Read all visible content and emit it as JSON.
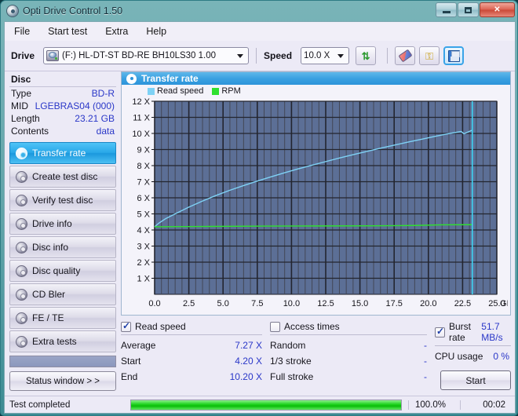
{
  "window": {
    "title": "Opti Drive Control 1.50",
    "app_icon": "disc-icon",
    "minimize": "minimize-icon",
    "maximize": "maximize-icon",
    "close": "✕"
  },
  "menu": [
    "File",
    "Start test",
    "Extra",
    "Help"
  ],
  "toolbar": {
    "drive_label": "Drive",
    "drive_value": "(F:)  HL-DT-ST BD-RE  BH10LS30 1.00",
    "speed_label": "Speed",
    "speed_value": "10.0 X",
    "refresh_icon": "refresh-icon",
    "eraser_icon": "eraser-icon",
    "key_icon": "key-icon",
    "save_icon": "save-icon"
  },
  "disc": {
    "heading": "Disc",
    "rows": [
      {
        "label": "Type",
        "value": "BD-R"
      },
      {
        "label": "MID",
        "value": "LGEBRAS04 (000)"
      },
      {
        "label": "Length",
        "value": "23.21 GB"
      },
      {
        "label": "Contents",
        "value": "data"
      }
    ]
  },
  "sidebar": {
    "items": [
      {
        "label": "Transfer rate",
        "selected": true
      },
      {
        "label": "Create test disc",
        "selected": false
      },
      {
        "label": "Verify test disc",
        "selected": false
      },
      {
        "label": "Drive info",
        "selected": false
      },
      {
        "label": "Disc info",
        "selected": false
      },
      {
        "label": "Disc quality",
        "selected": false
      },
      {
        "label": "CD Bler",
        "selected": false
      },
      {
        "label": "FE / TE",
        "selected": false
      },
      {
        "label": "Extra tests",
        "selected": false
      }
    ],
    "status_window_button": "Status window > >"
  },
  "chart_panel": {
    "header": "Transfer rate",
    "legend": [
      {
        "name": "Read speed",
        "color": "#7fd2f5"
      },
      {
        "name": "RPM",
        "color": "#2fe02f"
      }
    ]
  },
  "chart_data": {
    "type": "line",
    "title": "Transfer rate",
    "xlabel": "GB",
    "ylabel": "X",
    "xlim": [
      0.0,
      25.0
    ],
    "ylim": [
      0,
      12
    ],
    "xticks": [
      "0.0",
      "2.5",
      "5.0",
      "7.5",
      "10.0",
      "12.5",
      "15.0",
      "17.5",
      "20.0",
      "22.5",
      "25.0"
    ],
    "xtick_values": [
      0.0,
      2.5,
      5.0,
      7.5,
      10.0,
      12.5,
      15.0,
      17.5,
      20.0,
      22.5,
      25.0
    ],
    "x_unit": "GB",
    "yticks": [
      "1 X",
      "2 X",
      "3 X",
      "4 X",
      "5 X",
      "6 X",
      "7 X",
      "8 X",
      "9 X",
      "10 X",
      "11 X",
      "12 X"
    ],
    "ytick_values": [
      1,
      2,
      3,
      4,
      5,
      6,
      7,
      8,
      9,
      10,
      11,
      12
    ],
    "grid": true,
    "plot_bg": "#5c6f96",
    "grid_color": "#333644",
    "legend_position": "top-left",
    "cursor_line": {
      "x": 23.21,
      "color": "#3fd2f0"
    },
    "series": [
      {
        "name": "Read speed",
        "color": "#7fd2f5",
        "x": [
          0.0,
          0.3,
          0.8,
          1.5,
          2.5,
          3.5,
          4.5,
          5.5,
          6.5,
          7.5,
          8.5,
          9.5,
          10.5,
          11.5,
          12.5,
          13.5,
          14.5,
          15.5,
          16.5,
          17.5,
          18.5,
          19.5,
          20.5,
          21.5,
          22.4,
          22.6,
          23.2
        ],
        "y": [
          4.2,
          4.42,
          4.7,
          5.0,
          5.42,
          5.8,
          6.15,
          6.47,
          6.76,
          7.04,
          7.3,
          7.56,
          7.8,
          8.03,
          8.25,
          8.47,
          8.68,
          8.88,
          9.08,
          9.27,
          9.46,
          9.64,
          9.82,
          9.99,
          10.12,
          9.98,
          10.2
        ]
      },
      {
        "name": "RPM",
        "color": "#2fe02f",
        "x": [
          0.0,
          4.0,
          8.0,
          12.0,
          16.0,
          19.0,
          21.0,
          23.2
        ],
        "y": [
          4.2,
          4.22,
          4.24,
          4.25,
          4.26,
          4.28,
          4.32,
          4.33
        ]
      }
    ]
  },
  "results": {
    "read_speed": {
      "checkbox_label": "Read speed",
      "checked": true,
      "rows": [
        {
          "label": "Average",
          "value": "7.27 X"
        },
        {
          "label": "Start",
          "value": "4.20 X"
        },
        {
          "label": "End",
          "value": "10.20 X"
        }
      ]
    },
    "access_times": {
      "checkbox_label": "Access times",
      "checked": false,
      "rows": [
        {
          "label": "Random",
          "value": "-"
        },
        {
          "label": "1/3 stroke",
          "value": "-"
        },
        {
          "label": "Full stroke",
          "value": "-"
        }
      ]
    },
    "burst_rate": {
      "checkbox_label": "Burst rate",
      "checked": true,
      "value": "51.7 MB/s",
      "rows": [
        {
          "label": "CPU usage",
          "value": "0 %"
        }
      ]
    },
    "start_button": "Start"
  },
  "statusbar": {
    "text": "Test completed",
    "progress_percent": "100.0%",
    "progress_value": 100,
    "elapsed": "00:02"
  }
}
